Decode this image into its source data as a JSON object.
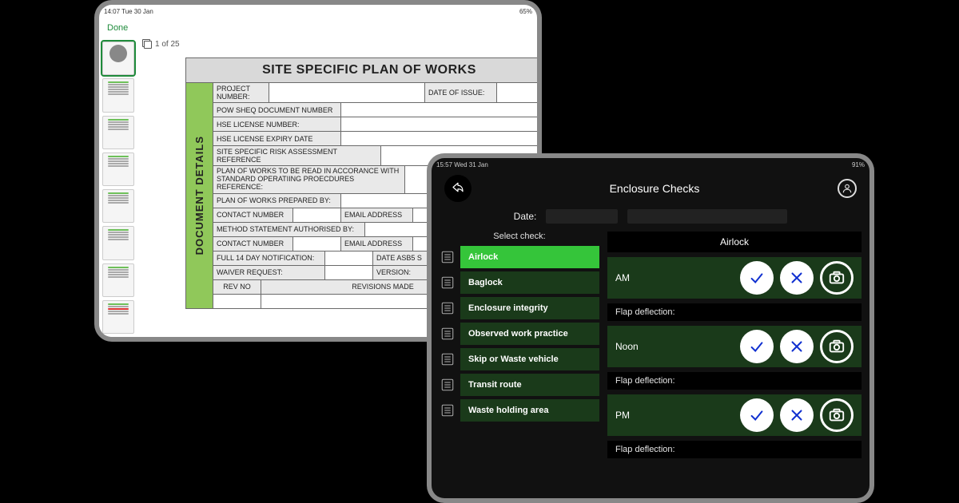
{
  "tablet1": {
    "status": {
      "left": "14:07  Tue 30 Jan",
      "right": "65%"
    },
    "done_label": "Done",
    "page_counter": "1 of 25",
    "title": "SITE SPECIFIC PLAN OF WORKS",
    "side_label": "DOCUMENT DETAILS",
    "rows": {
      "project_number": "PROJECT NUMBER:",
      "date_of_issue": "DATE OF ISSUE:",
      "pow_sheq": "POW SHEQ DOCUMENT NUMBER",
      "hse_license": "HSE LICENSE NUMBER:",
      "hse_expiry": "HSE LICENSE EXPIRY DATE",
      "risk_ref": "SITE SPECIFIC RISK ASSESSMENT REFERENCE",
      "plan_read": "PLAN OF WORKS TO BE READ IN ACCORANCE WITH STANDARD OPERATIING PROECDURES REFERENCE:",
      "prepared_by": "PLAN OF WORKS PREPARED BY:",
      "contact_number": "CONTACT NUMBER",
      "email_address": "EMAIL ADDRESS",
      "method_auth": "METHOD STATEMENT AUTHORISED BY:",
      "full_14": "FULL 14 DAY NOTIFICATION:",
      "date_asb5": "DATE ASB5 S",
      "waiver": "WAIVER REQUEST:",
      "version": "VERSION:",
      "rev_no": "REV NO",
      "revisions_made": "REVISIONS MADE",
      "revisio": "REVISIO"
    }
  },
  "tablet2": {
    "status": {
      "left": "15:57  Wed 31 Jan",
      "right": "91%"
    },
    "title": "Enclosure Checks",
    "date_label": "Date:",
    "select_label": "Select check:",
    "checks": [
      "Airlock",
      "Baglock",
      "Enclosure integrity",
      "Observed work practice",
      "Skip or Waste vehicle",
      "Transit route",
      "Waste holding area"
    ],
    "detail_title": "Airlock",
    "periods": [
      "AM",
      "Noon",
      "PM"
    ],
    "flap_label": "Flap deflection:"
  }
}
